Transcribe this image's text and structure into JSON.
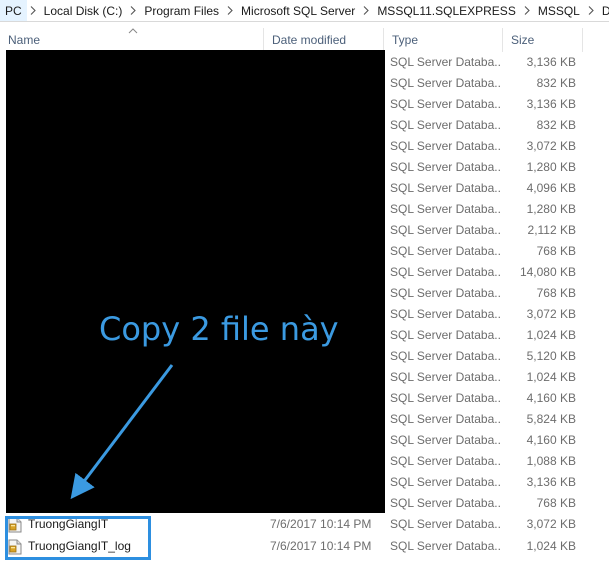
{
  "breadcrumb": {
    "items": [
      "PC",
      "Local Disk (C:)",
      "Program Files",
      "Microsoft SQL Server",
      "MSSQL11.SQLEXPRESS",
      "MSSQL",
      "DATA"
    ]
  },
  "columns": {
    "name": "Name",
    "date_modified": "Date modified",
    "type": "Type",
    "size": "Size"
  },
  "hidden_rows": [
    {
      "type": "SQL Server Databa...",
      "size": "3,136 KB"
    },
    {
      "type": "SQL Server Databa...",
      "size": "832 KB"
    },
    {
      "type": "SQL Server Databa...",
      "size": "3,136 KB"
    },
    {
      "type": "SQL Server Databa...",
      "size": "832 KB"
    },
    {
      "type": "SQL Server Databa...",
      "size": "3,072 KB"
    },
    {
      "type": "SQL Server Databa...",
      "size": "1,280 KB"
    },
    {
      "type": "SQL Server Databa...",
      "size": "4,096 KB"
    },
    {
      "type": "SQL Server Databa...",
      "size": "1,280 KB"
    },
    {
      "type": "SQL Server Databa...",
      "size": "2,112 KB"
    },
    {
      "type": "SQL Server Databa...",
      "size": "768 KB"
    },
    {
      "type": "SQL Server Databa...",
      "size": "14,080 KB"
    },
    {
      "type": "SQL Server Databa...",
      "size": "768 KB"
    },
    {
      "type": "SQL Server Databa...",
      "size": "3,072 KB"
    },
    {
      "type": "SQL Server Databa...",
      "size": "1,024 KB"
    },
    {
      "type": "SQL Server Databa...",
      "size": "5,120 KB"
    },
    {
      "type": "SQL Server Databa...",
      "size": "1,024 KB"
    },
    {
      "type": "SQL Server Databa...",
      "size": "4,160 KB"
    },
    {
      "type": "SQL Server Databa...",
      "size": "5,824 KB"
    },
    {
      "type": "SQL Server Databa...",
      "size": "4,160 KB"
    },
    {
      "type": "SQL Server Databa...",
      "size": "1,088 KB"
    },
    {
      "type": "SQL Server Databa...",
      "size": "3,136 KB"
    },
    {
      "type": "SQL Server Databa...",
      "size": "768 KB"
    }
  ],
  "files": [
    {
      "name": "TruongGiangIT",
      "date": "7/6/2017 10:14 PM",
      "type": "SQL Server Databa...",
      "size": "3,072 KB"
    },
    {
      "name": "TruongGiangIT_log",
      "date": "7/6/2017 10:14 PM",
      "type": "SQL Server Databa...",
      "size": "1,024 KB"
    }
  ],
  "annotation": {
    "text": "Copy 2 file này",
    "color": "#3b9ae1",
    "highlight_color": "#2d8fe0"
  }
}
